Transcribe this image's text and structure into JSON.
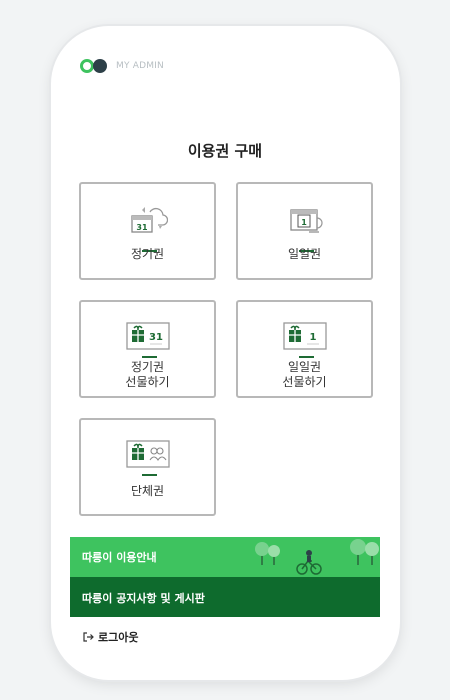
{
  "header": {
    "admin_label": "MY ADMIN"
  },
  "title": "이용권 구매",
  "cards": [
    {
      "label": "정기권",
      "icon": "calendar-sync-icon"
    },
    {
      "label": "일일권",
      "icon": "calendar-day-icon"
    },
    {
      "label": "정기권\n선물하기",
      "icon": "gift-ticket-31-icon"
    },
    {
      "label": "일일권\n선물하기",
      "icon": "gift-ticket-1-icon"
    },
    {
      "label": "단체권",
      "icon": "gift-ticket-group-icon"
    }
  ],
  "menu": {
    "guide": "따릉이 이용안내",
    "notice": "따릉이 공지사항 및 게시판",
    "logout": "로그아웃"
  },
  "icons": {
    "day_number": "1",
    "month_number": "31"
  },
  "colors": {
    "accent": "#3ec35f",
    "dark_green": "#0e6b2d",
    "card_border": "#b8b8b8"
  }
}
